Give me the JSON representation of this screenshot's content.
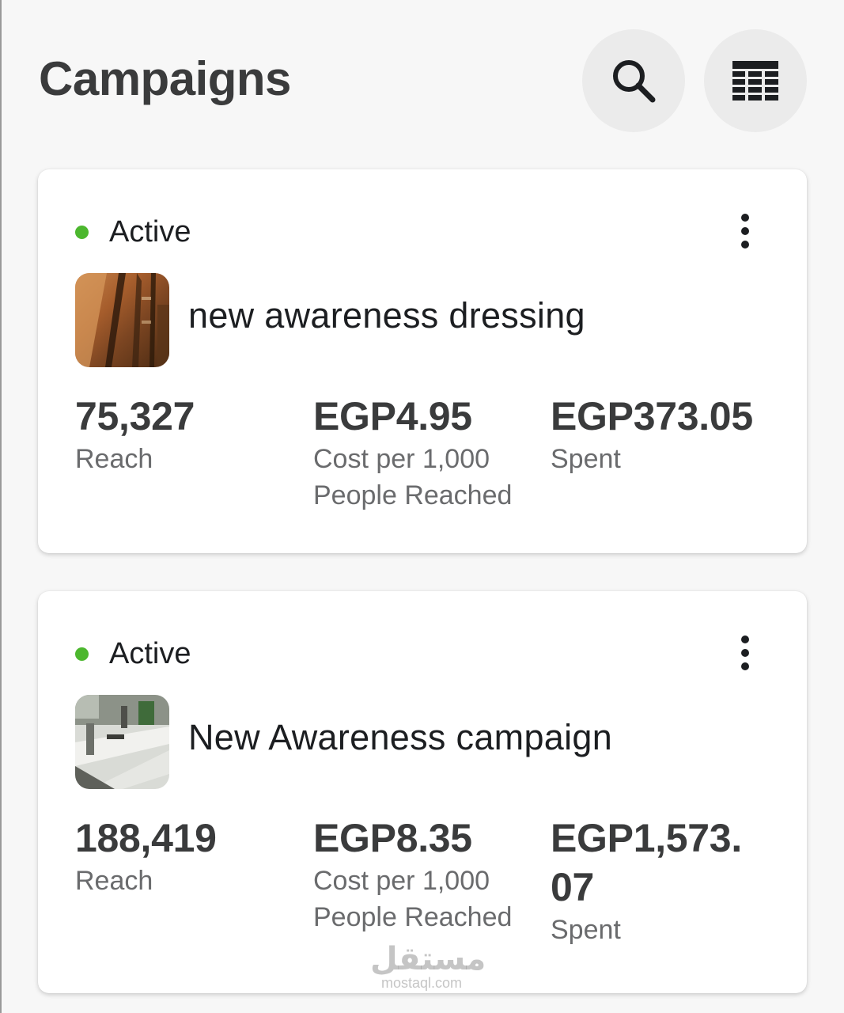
{
  "header": {
    "title": "Campaigns",
    "search_icon": "search-icon",
    "table_icon": "table-view-icon"
  },
  "colors": {
    "active_status": "#4cb72e",
    "title_text": "#3a3b3c",
    "label_text": "#6a6b6d",
    "icon_button_bg": "#ebebeb"
  },
  "campaigns": [
    {
      "status": "Active",
      "name": "new awareness dressing",
      "thumbnail_icon": "wooden-wardrobe-image",
      "metrics": {
        "reach_value": "75,327",
        "reach_label": "Reach",
        "cpm_value": "EGP4.95",
        "cpm_label": "Cost per 1,000 People Reached",
        "spent_value": "EGP373.05",
        "spent_label": "Spent"
      }
    },
    {
      "status": "Active",
      "name": "New Awareness campaign",
      "thumbnail_icon": "workshop-image",
      "metrics": {
        "reach_value": "188,419",
        "reach_label": "Reach",
        "cpm_value": "EGP8.35",
        "cpm_label": "Cost per 1,000 People Reached",
        "spent_value": "EGP1,573.07",
        "spent_label": "Spent"
      }
    }
  ],
  "watermark": {
    "arabic": "مستقل",
    "latin": "mostaql.com"
  }
}
